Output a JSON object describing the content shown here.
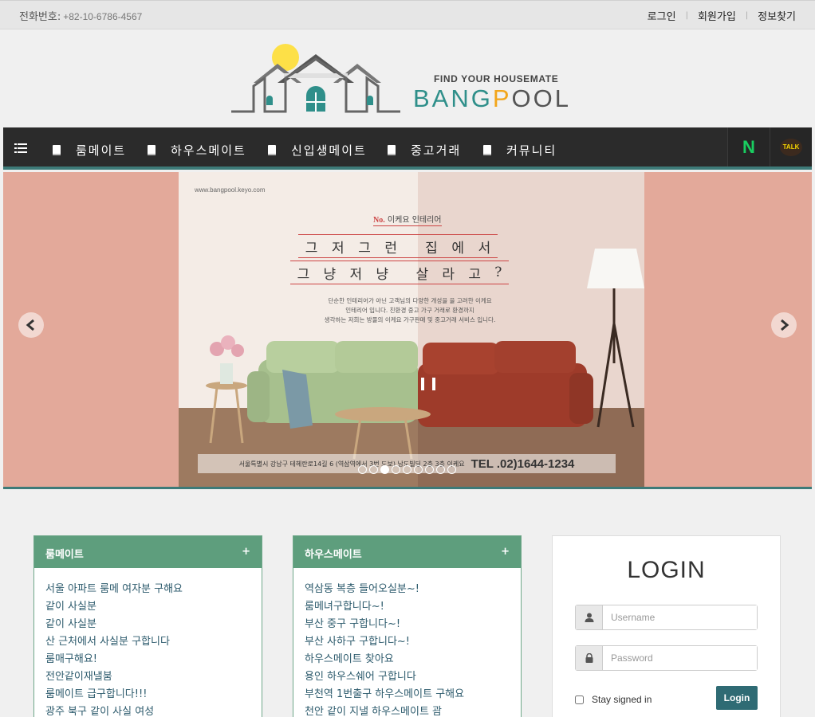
{
  "header": {
    "phone_label": "전화번호:",
    "phone_number": "+82-10-6786-4567",
    "links": [
      "로그인",
      "회원가입",
      "정보찾기"
    ]
  },
  "logo": {
    "tagline": "FIND YOUR HOUSEMATE",
    "name_part1": "BANG",
    "name_part2": "P",
    "name_part3": "OOL",
    "accent_teal": "#2f8f8a",
    "accent_orange": "#f2a51a"
  },
  "nav": {
    "menu_icon": "list-icon",
    "items": [
      "룸메이트",
      "하우스메이트",
      "신입생메이트",
      "중고거래",
      "커뮤니티"
    ],
    "naver_label": "N",
    "talk_label": "TALK"
  },
  "slider": {
    "url": "www.bangpool.keyo.com",
    "no_label": "No.",
    "no_text": "이케요 인테리어",
    "headline1": [
      "그",
      "저",
      "그",
      "런",
      "",
      "집",
      "에",
      "서"
    ],
    "headline2": [
      "그",
      "냥",
      "저",
      "냥",
      "",
      "살",
      "라",
      "고",
      "?"
    ],
    "desc_lines": [
      "단순한 인테리어가 아닌 고객님의 다양한 개성을 을 고려한 이케요",
      "인테리어 입니다. 친환경 중고 가구 거래로 환경까지",
      "생각하는 저희는 방풀의 이케요 가구판매 및 중고거래 서비스 입니다."
    ],
    "banner_text": "서울특별시 강남구 테헤란로14길 6 (역삼역에서 3번 도보) 남도빌딩 2층 3층 이케요",
    "banner_tel": "TEL .02)1644-1234",
    "dot_count": 9,
    "active_dot": 2,
    "bg_color": "#e3a99a"
  },
  "panels": [
    {
      "title": "룸메이트",
      "plus": "+",
      "items": [
        "서울 아파트 룸메 여자분 구해요",
        "같이 사실분",
        "같이 사실분",
        "산 근처에서 사실분 구합니다",
        "룸매구해요!",
        "전안같이재낼붐",
        "룸메이트 급구합니다!!!",
        "광주 북구 같이 사실 여성"
      ]
    },
    {
      "title": "하우스메이트",
      "plus": "+",
      "items": [
        "역삼동 복층 들어오실분~!",
        "룸메녀구합니다~!",
        "부산 중구 구합니다~!",
        "부산 사하구 구합니다~!",
        "하우스메이트 찾아요",
        "용인 하우스쉐어 구합니다",
        "부천역 1번출구 하우스메이트 구해요",
        "천안 같이 지낼 하우스메이트 괌"
      ]
    }
  ],
  "login": {
    "title": "LOGIN",
    "username_placeholder": "Username",
    "password_placeholder": "Password",
    "stay_label": "Stay signed in",
    "button_label": "Login",
    "button_color": "#2f6b74"
  }
}
